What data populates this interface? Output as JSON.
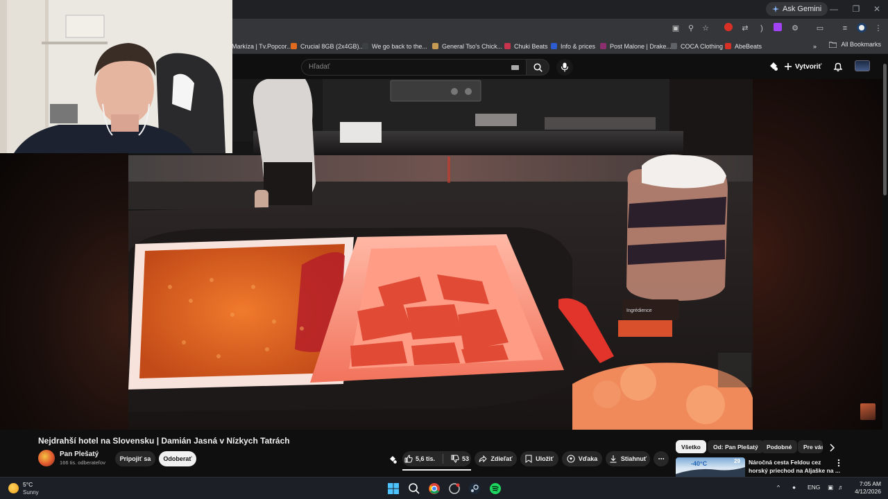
{
  "browser": {
    "ask_gemini": "Ask Gemini",
    "bookmarks": [
      {
        "label": "Markíza | Tv.Popcor...",
        "color": "#1f76d2"
      },
      {
        "label": "Crucial 8GB (2x4GB)...",
        "color": "#e06a1e"
      },
      {
        "label": "We go back to the...",
        "color": "#3c4043"
      },
      {
        "label": "General Tso's Chick...",
        "color": "#c79b54"
      },
      {
        "label": "Chuki Beats",
        "color": "#c8344d"
      },
      {
        "label": "Info & prices",
        "color": "#2d5bd0"
      },
      {
        "label": "Post Malone | Drake...",
        "color": "#8b2f6e"
      },
      {
        "label": "COCA Clothing",
        "color": "#5f6368"
      },
      {
        "label": "AbeBeats",
        "color": "#d93025"
      }
    ],
    "all_bookmarks": "All Bookmarks"
  },
  "youtube": {
    "search_placeholder": "Hľadať",
    "create_label": "Vytvoriť"
  },
  "video": {
    "title": "Nejdrahší hotel na Slovensku | Damián Jasná v Nízkych Tatrách",
    "channel": {
      "name": "Pan Plešatý",
      "subscribers": "166 tis. odberateľov"
    },
    "join_label": "Pripojiť sa",
    "subscribe_label": "Odoberať",
    "actions": {
      "likes": "5,6 tis.",
      "dislikes": "53",
      "share": "Zdieľať",
      "save": "Uložiť",
      "thanks": "Vďaka",
      "download": "Stiahnuť"
    },
    "jar_label": "Ingrédience"
  },
  "sidebar": {
    "chips": [
      "Všetko",
      "Od: Pan Plešatý",
      "Podobné",
      "Pre vás"
    ],
    "recommendation": {
      "title_line1": "Náročná cesta Feldou cez",
      "title_line2": "horský priechod na Aljaške na ...",
      "thumb_count": "29"
    }
  },
  "taskbar": {
    "temperature": "5°C",
    "condition": "Sunny",
    "language": "ENG",
    "time": "7:05 AM",
    "date": "4/12/2026"
  },
  "colors": {
    "youtube_bg": "#0f0f0f",
    "chip_bg": "#272727",
    "taskbar_bg": "#1c2026"
  }
}
